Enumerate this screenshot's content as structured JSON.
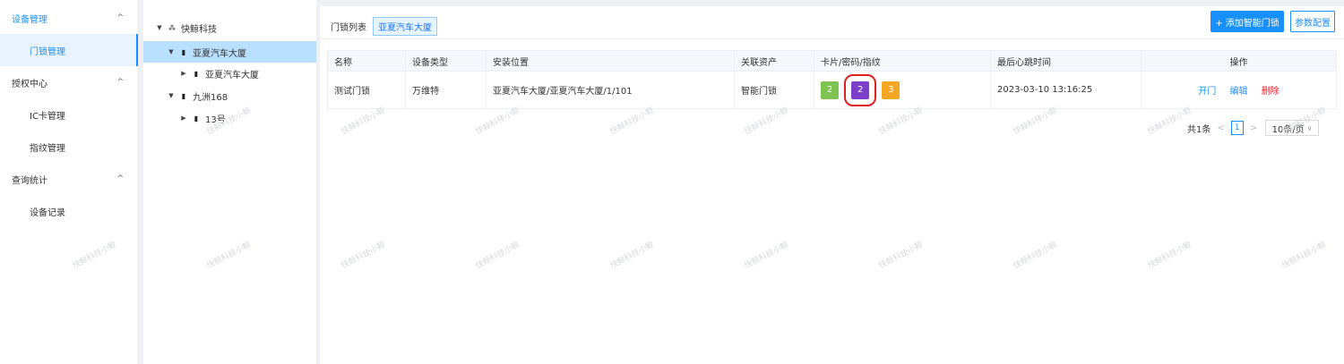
{
  "sidebar": {
    "groups": [
      {
        "label": "设备管理",
        "chevron": "^",
        "items": [
          {
            "label": "门锁管理"
          }
        ]
      },
      {
        "label": "授权中心",
        "chevron": "^",
        "items": [
          {
            "label": "IC卡管理"
          },
          {
            "label": "指纹管理"
          }
        ]
      },
      {
        "label": "查询统计",
        "chevron": "^",
        "items": [
          {
            "label": "设备记录"
          }
        ]
      }
    ]
  },
  "tree": {
    "root": "快鲸科技",
    "nodes": [
      "亚夏汽车大厦",
      "亚夏汽车大厦",
      "九洲168",
      "13号"
    ]
  },
  "main": {
    "title": "门锁列表",
    "selected_tag": "亚夏汽车大厦",
    "add_button": "+ 添加智能门锁",
    "config_button": "参数配置",
    "columns": [
      "名称",
      "设备类型",
      "安装位置",
      "关联资产",
      "卡片/密码/指纹",
      "最后心跳时间",
      "操作"
    ],
    "row": {
      "name": "测试门锁",
      "device_type": "万维特",
      "location": "亚夏汽车大厦/亚夏汽车大厦/1/101",
      "asset": "智能门锁",
      "cards": "2",
      "passwords": "2",
      "fingerprints": "3",
      "heartbeat": "2023-03-10 13:16:25",
      "actions": [
        "开门",
        "编辑",
        "删除"
      ]
    },
    "pagination": {
      "total": "共1条",
      "page": "1",
      "page_size": "10条/页"
    }
  },
  "colors": {
    "primary": "#1890ff",
    "card_chip": "#7ec24f",
    "password_chip": "#7b3fc9",
    "fingerprint_chip": "#f5a623",
    "delete": "#f5222d",
    "highlight": "#e02020"
  },
  "watermark": "快鲸科技小鲸"
}
